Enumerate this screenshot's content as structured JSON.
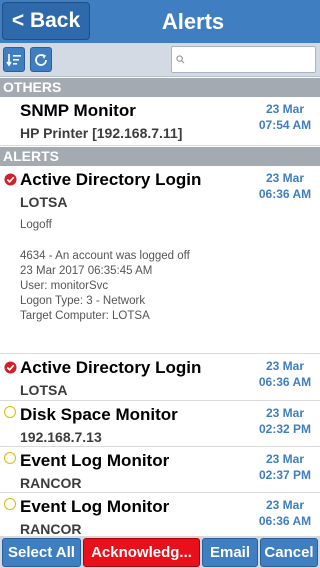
{
  "header": {
    "back_label": "< Back",
    "title": "Alerts"
  },
  "toolbar": {
    "sort_icon": "sort-icon",
    "refresh_icon": "refresh-icon",
    "search_placeholder": "",
    "search_icon": "search-icon"
  },
  "sections": {
    "others": "OTHERS",
    "alerts": "ALERTS"
  },
  "others_items": [
    {
      "name": "SNMP Monitor",
      "sub": "HP Printer [192.168.7.11]",
      "date": "23 Mar",
      "time": "07:54 AM",
      "status": "none"
    }
  ],
  "alert_items": [
    {
      "name": "Active Directory Login",
      "sub": "LOTSA",
      "date": "23 Mar",
      "time": "06:36 AM",
      "status": "checked",
      "summary": "Logoff",
      "details": [
        "4634 - An account was logged off",
        "23 Mar 2017 06:35:45 AM",
        "User: monitorSvc",
        "Logon Type: 3 - Network",
        "Target Computer: LOTSA"
      ]
    },
    {
      "name": "Active Directory Login",
      "sub": "LOTSA",
      "date": "23 Mar",
      "time": "06:36 AM",
      "status": "checked"
    },
    {
      "name": "Disk Space Monitor",
      "sub": "192.168.7.13",
      "date": "23 Mar",
      "time": "02:32 PM",
      "status": "pending"
    },
    {
      "name": "Event Log Monitor",
      "sub": "RANCOR",
      "date": "23 Mar",
      "time": "02:37 PM",
      "status": "pending"
    },
    {
      "name": "Event Log Monitor",
      "sub": "RANCOR",
      "date": "23 Mar",
      "time": "06:36 AM",
      "status": "pending"
    }
  ],
  "bottom": {
    "select_all": "Select All",
    "acknowledge": "Acknowledg...",
    "email": "Email",
    "cancel": "Cancel"
  },
  "colors": {
    "primary": "#3f7ec0",
    "danger": "#e8101a",
    "section": "#a4aab2",
    "check": "#d0202a",
    "pending": "#d6c000"
  }
}
